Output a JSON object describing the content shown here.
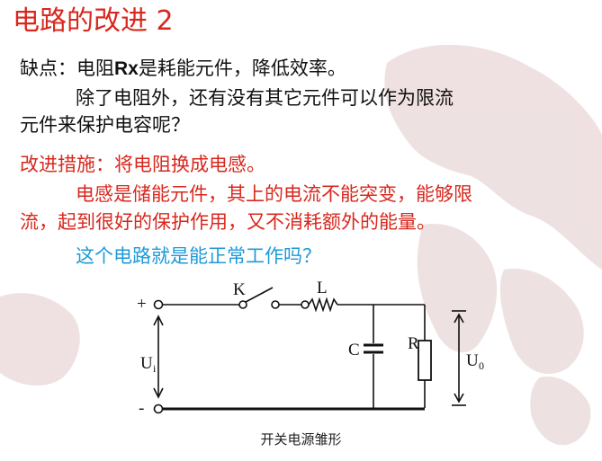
{
  "slide": {
    "title": "电路的改进 2",
    "line1_prefix": "缺点：电阻",
    "line1_rx": "Rx",
    "line1_suffix": "是耗能元件，降低效率。",
    "line2": "除了电阻外，还有没有其它元件可以作为限流",
    "line3": "元件来保护电容呢？",
    "line4": "改进措施：将电阻换成电感。",
    "line5": "电感是储能元件，其上的电流不能突变，能够限",
    "line6": "流，起到很好的保护作用，又不消耗额外的能量。",
    "line7": "这个电路就是能正常工作吗？"
  },
  "circuit": {
    "plus": "+",
    "minus": "-",
    "switch_label": "K",
    "inductor_label": "L",
    "capacitor_label": "C",
    "resistor_label": "R",
    "input_label": "U",
    "input_sub": "i",
    "output_label": "U",
    "output_sub": "0",
    "caption": "开关电源雏形"
  },
  "colors": {
    "title": "#d8281e",
    "body_black": "#111111",
    "body_red": "#d8281e",
    "body_blue": "#1f9ad8"
  }
}
